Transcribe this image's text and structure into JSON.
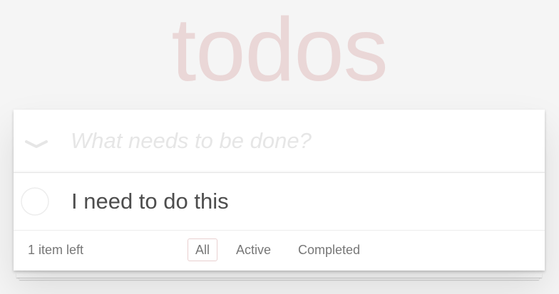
{
  "header": {
    "title": "todos"
  },
  "new_todo": {
    "placeholder": "What needs to be done?",
    "value": ""
  },
  "toggle_all": {
    "icon": "chevron-down-icon"
  },
  "todos": [
    {
      "title": "I need to do this",
      "completed": false,
      "icon": "circle-check-icon"
    }
  ],
  "footer": {
    "count_text": "1 item left",
    "filters": [
      {
        "label": "All",
        "selected": true
      },
      {
        "label": "Active",
        "selected": false
      },
      {
        "label": "Completed",
        "selected": false
      }
    ]
  },
  "colors": {
    "title": "#ead7d7",
    "selected_filter_border": "#e9d0d0",
    "text": "#4d4d4d",
    "muted": "#777777",
    "background": "#f5f5f5"
  }
}
